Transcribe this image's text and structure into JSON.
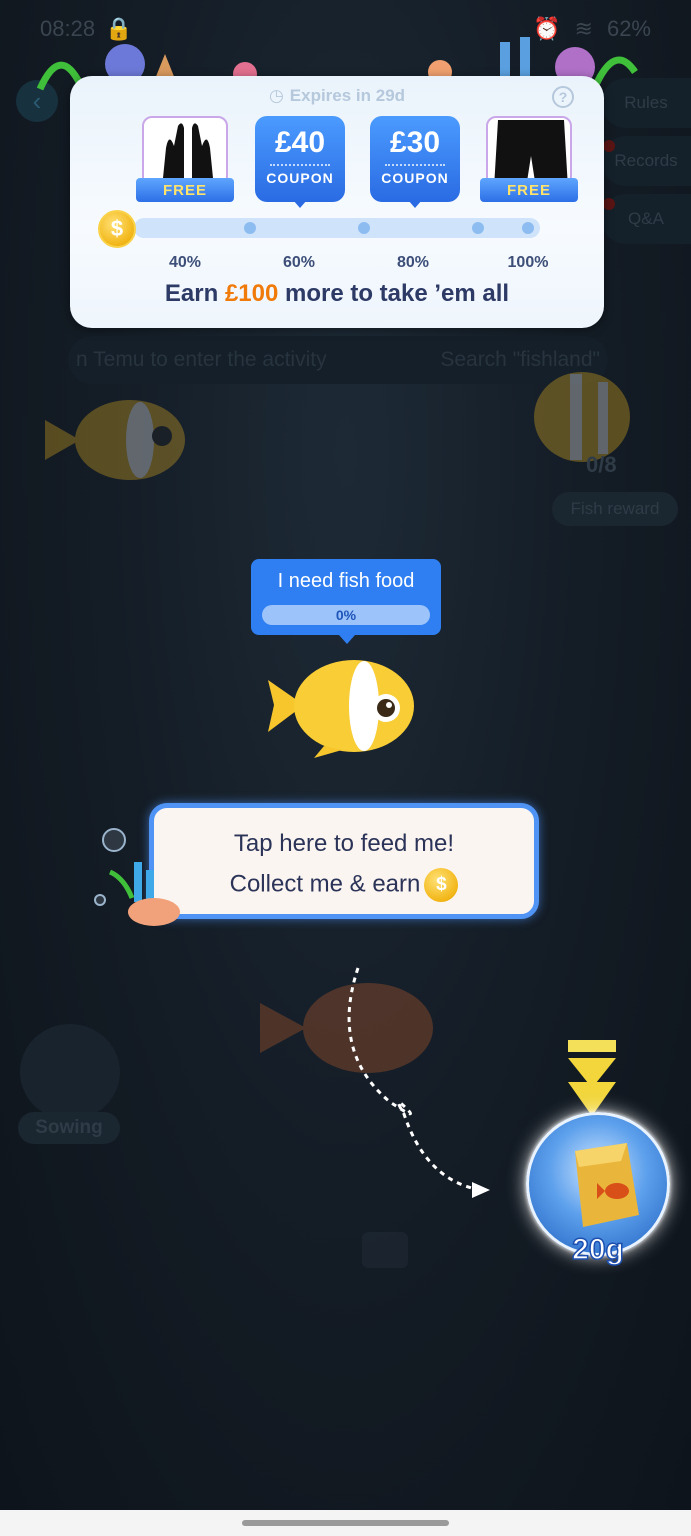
{
  "status_bar": {
    "time": "08:28",
    "battery": "62%"
  },
  "side_menu": [
    "Rules",
    "Records",
    "Q&A"
  ],
  "search_strip": {
    "left_text": "n Temu to enter the activity",
    "right_text": "Search \"fishland\""
  },
  "reward_card": {
    "expires": "Expires in 29d",
    "tiers": [
      {
        "type": "product",
        "badge": "FREE",
        "percent": "40%",
        "icon": "gloves-icon"
      },
      {
        "type": "coupon",
        "amount": "£40",
        "label": "COUPON",
        "percent": "60%"
      },
      {
        "type": "coupon",
        "amount": "£30",
        "label": "COUPON",
        "percent": "80%"
      },
      {
        "type": "product",
        "badge": "FREE",
        "percent": "100%",
        "icon": "shorts-icon"
      }
    ],
    "earn_prefix": "Earn",
    "earn_amount": "£100",
    "earn_suffix": "more to take ’em all"
  },
  "fish_reward": {
    "count": "0/8",
    "label": "Fish reward"
  },
  "food_bubble": {
    "title": "I need fish food",
    "progress": "0%"
  },
  "tap_card": {
    "line1": "Tap here to feed me!",
    "line2": "Collect me & earn"
  },
  "sowing": {
    "label": "Sowing"
  },
  "food_orb": {
    "amount": "20g"
  },
  "colors": {
    "accent_blue": "#2f7ff2",
    "earn_orange": "#f07b0a",
    "coin_gold": "#f2b617"
  }
}
